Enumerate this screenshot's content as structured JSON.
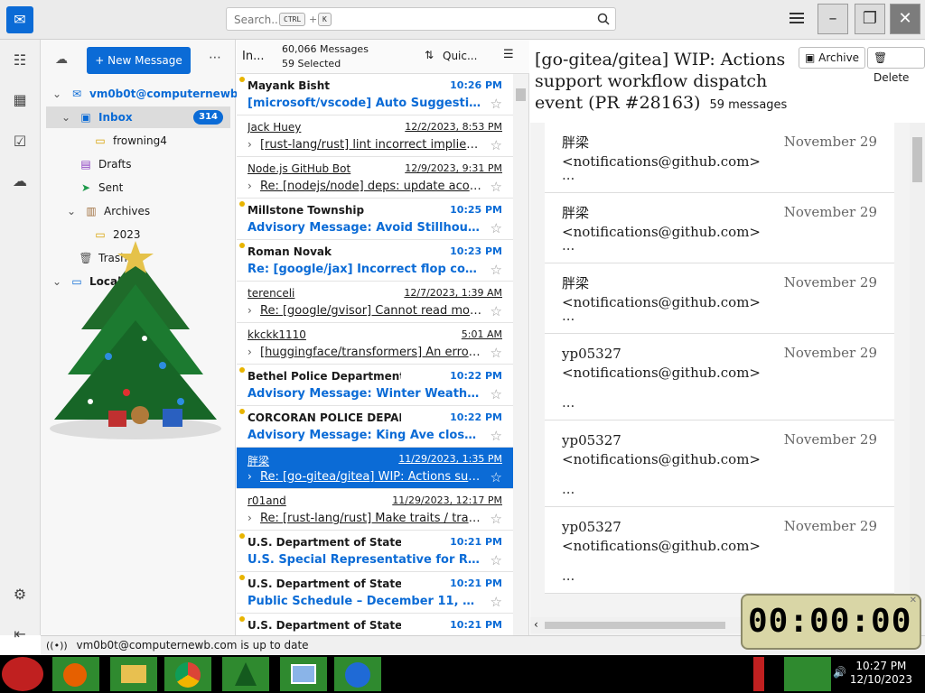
{
  "search": {
    "placeholder": "Search...",
    "key_ctrl": "CTRL",
    "plus": "+",
    "key_k": "K"
  },
  "folders": {
    "new_message": "New Message",
    "account": "vm0b0t@computernewb.com",
    "account_display": "vm0b0t@computernewb...",
    "inbox": "Inbox",
    "inbox_count": "314",
    "frowning": "frowning4",
    "drafts": "Drafts",
    "sent": "Sent",
    "archives": "Archives",
    "archive_year": "2023",
    "trash": "Trash",
    "local": "Local Folders",
    "local_display": "Local F"
  },
  "list": {
    "folder_short": "In...",
    "messages_count": "60,066 Messages",
    "selected_count": "59 Selected",
    "quick_filter": "Quic...",
    "rows": [
      {
        "from": "Mayank Bisht",
        "date": "10:26 PM",
        "subject": "[microsoft/vscode] Auto Suggestion Fre...",
        "state": "unread"
      },
      {
        "from": "Jack Huey",
        "date": "12/2/2023, 8:53 PM",
        "subject": "[rust-lang/rust] lint incorrect implied bo...",
        "state": "read"
      },
      {
        "from": "Node.js GitHub Bot",
        "date": "12/9/2023, 9:31 PM",
        "subject": "Re: [nodejs/node] deps: update acorn-...",
        "state": "read"
      },
      {
        "from": "Millstone Township",
        "date": "10:25 PM",
        "subject": "Advisory Message: Avoid Stillhouse goi...",
        "state": "unread"
      },
      {
        "from": "Roman Novak",
        "date": "10:23 PM",
        "subject": "Re: [google/jax] Incorrect flop count es...",
        "state": "unread"
      },
      {
        "from": "terenceli",
        "date": "12/7/2023, 1:39 AM",
        "subject": "Re: [google/gvisor] Cannot read mount...",
        "state": "read"
      },
      {
        "from": "kkckk1110",
        "date": "5:01 AM",
        "subject": "[huggingface/transformers] An error wh...",
        "state": "read"
      },
      {
        "from": "Bethel Police Department AK",
        "date": "10:22 PM",
        "subject": "Advisory Message: Winter Weather Adv...",
        "state": "unread"
      },
      {
        "from": "CORCORAN POLICE DEPARTMENT",
        "date": "10:22 PM",
        "subject": "Advisory Message: King Ave closed bet...",
        "state": "unread"
      },
      {
        "from": "胖梁",
        "date": "11/29/2023, 1:35 PM",
        "subject": "Re: [go-gitea/gitea] WIP: Actions suppor...",
        "state": "selected"
      },
      {
        "from": "r01and",
        "date": "11/29/2023, 12:17 PM",
        "subject": "Re: [rust-lang/rust] Make traits / trait me...",
        "state": "read"
      },
      {
        "from": "U.S. Department of State",
        "date": "10:21 PM",
        "subject": "U.S. Special Representative for Racial Eq...",
        "state": "unread"
      },
      {
        "from": "U.S. Department of State",
        "date": "10:21 PM",
        "subject": "Public Schedule – December 11, 2023",
        "state": "unread"
      },
      {
        "from": "U.S. Department of State",
        "date": "10:21 PM",
        "subject": "",
        "state": "unread"
      }
    ]
  },
  "reader": {
    "title": "[go-gitea/gitea] WIP: Actions support workflow dispatch event (PR #28163)",
    "count": "59 messages",
    "archive": "Archive",
    "delete": "Delete",
    "messages": [
      {
        "sender": "胖梁 <notifications@github.com>",
        "date": "November 29",
        "snippet": "..."
      },
      {
        "sender": "胖梁 <notifications@github.com>",
        "date": "November 29",
        "snippet": "..."
      },
      {
        "sender": "胖梁 <notifications@github.com>",
        "date": "November 29",
        "snippet": "..."
      },
      {
        "sender": "yp05327 <notifications@github.com>",
        "date": "November 29",
        "snippet": "..."
      },
      {
        "sender": "yp05327 <notifications@github.com>",
        "date": "November 29",
        "snippet": "..."
      },
      {
        "sender": "yp05327 <notifications@github.com>",
        "date": "November 29",
        "snippet": "..."
      }
    ]
  },
  "status": {
    "text": "vm0b0t@computernewb.com is up to date"
  },
  "timer": {
    "digits": "00:00:00"
  },
  "clock": {
    "time": "10:27 PM",
    "date": "12/10/2023"
  },
  "colors": {
    "accent": "#0b6bd6",
    "unread_dot": "#e8b400",
    "taskbar": "#000000"
  }
}
